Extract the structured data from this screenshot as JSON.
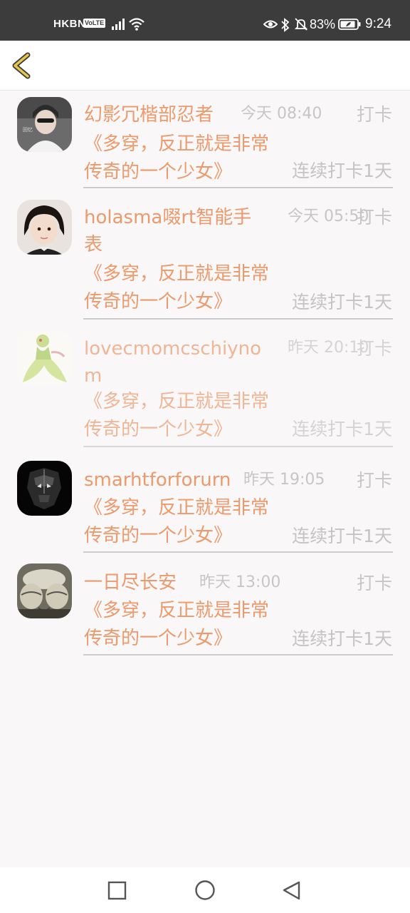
{
  "status_bar": {
    "carrier": "HKBN",
    "volte": "VoLTE",
    "battery_percent": "83%",
    "time": "9:24",
    "icons": [
      "signal-icon",
      "wifi-icon",
      "eye-icon",
      "bluetooth-icon",
      "bell-off-icon",
      "battery-saver-icon"
    ]
  },
  "toolbar": {
    "back_icon": "chevron-left-icon"
  },
  "entries": [
    {
      "username": "幻影冗楷部忍者",
      "time": "今天 08:40",
      "action": "打卡",
      "book": "《多穿，反正就是非常传奇的一个少女》",
      "streak": "连续打卡1天"
    },
    {
      "username": "holasma啜rt智能手表",
      "time": "今天 05:50",
      "action": "打卡",
      "book": "《多穿，反正就是非常传奇的一个少女》",
      "streak": "连续打卡1天"
    },
    {
      "username": "lovecmomcschiynom",
      "time": "昨天 20:10",
      "action": "打卡",
      "book": "《多穿，反正就是非常传奇的一个少女》",
      "streak": "连续打卡1天"
    },
    {
      "username": "smarhtforforurn",
      "time": "昨天 19:05",
      "action": "打卡",
      "book": "《多穿，反正就是非常传奇的一个少女》",
      "streak": "连续打卡1天"
    },
    {
      "username": "一日尽长安",
      "time": "昨天 13:00",
      "action": "打卡",
      "book": "《多穿，反正就是非常传奇的一个少女》",
      "streak": "连续打卡1天"
    }
  ],
  "colors": {
    "accent": "#ec9a6c",
    "muted": "#c6c6c6",
    "status_bar": "#3c3c3c",
    "background": "#f9f7f8",
    "back_icon": "#c8a93a"
  },
  "nav_bar": {
    "icons": [
      "recent-apps-icon",
      "home-icon",
      "back-icon"
    ]
  }
}
